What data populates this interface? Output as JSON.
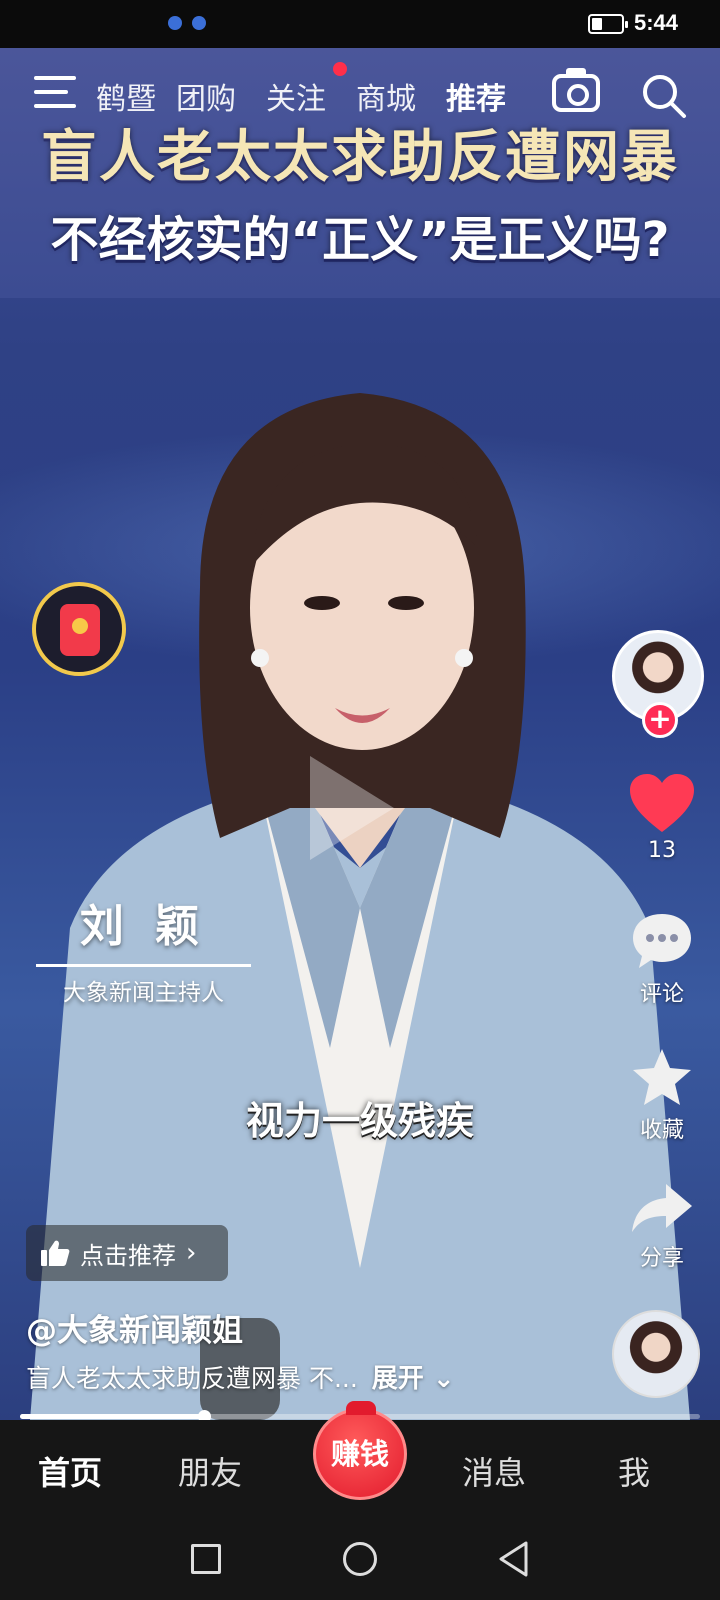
{
  "status_bar": {
    "time": "5:44",
    "battery_level": 0.35
  },
  "top_nav": {
    "tabs": [
      {
        "label": "鹤暨",
        "active": false
      },
      {
        "label": "团购",
        "active": false
      },
      {
        "label": "关注",
        "active": false,
        "badge": true
      },
      {
        "label": "商城",
        "active": false
      },
      {
        "label": "推荐",
        "active": true
      }
    ],
    "icons": [
      "menu-icon",
      "camera-icon",
      "search-icon"
    ]
  },
  "video": {
    "headline_line1": "盲人老太太求助反遭网暴",
    "headline_line2": "不经核实的“正义”是正义吗?",
    "anchor_name": "刘 颖",
    "anchor_title": "大象新闻主持人",
    "subtitle": "视力一级残疾",
    "progress": 0.27
  },
  "side_rail": {
    "like_count": "13",
    "comment_label": "评论",
    "favorite_label": "收藏",
    "share_label": "分享"
  },
  "recommend_label": "点击推荐",
  "author": "@大象新闻颖姐",
  "description": "盲人老太太求助反遭网暴 不...",
  "expand_label": "展开",
  "bottom_nav": {
    "home": "首页",
    "friends": "朋友",
    "earn": "赚钱",
    "messages": "消息",
    "me": "我"
  },
  "colors": {
    "accent": "#ff2c55",
    "headline": "#f5e6b6",
    "earn": "#e21b2d"
  }
}
